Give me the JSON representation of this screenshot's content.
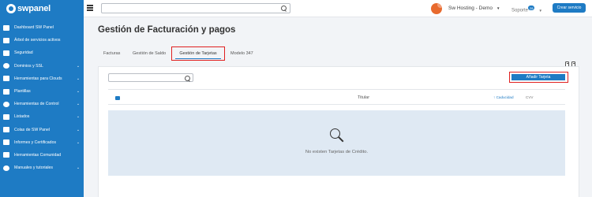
{
  "app": {
    "logo_text": "swpanel"
  },
  "sidebar": {
    "items": [
      {
        "label": "Dashboard SW Panel",
        "icon": "dashboard-icon",
        "has_children": false
      },
      {
        "label": "Árbol de servicios activos",
        "icon": "tree-icon",
        "has_children": false
      },
      {
        "label": "Seguridad",
        "icon": "shield-icon",
        "has_children": false
      },
      {
        "label": "Dominios y SSL",
        "icon": "globe-icon",
        "has_children": true
      },
      {
        "label": "Herramientas para Clouds",
        "icon": "toolbox-icon",
        "has_children": true
      },
      {
        "label": "Plantillas",
        "icon": "template-icon",
        "has_children": true
      },
      {
        "label": "Herramientas de Control",
        "icon": "check-circle-icon",
        "has_children": true
      },
      {
        "label": "Listados",
        "icon": "list-icon",
        "has_children": true
      },
      {
        "label": "Colas de SW Panel",
        "icon": "layers-icon",
        "has_children": true
      },
      {
        "label": "Informes y Certificados",
        "icon": "report-icon",
        "has_children": true
      },
      {
        "label": "Herramientas Comunidad",
        "icon": "community-icon",
        "has_children": false
      },
      {
        "label": "Manuales y tutoriales",
        "icon": "help-icon",
        "has_children": true
      }
    ],
    "chevron": "⌄"
  },
  "topbar": {
    "search_value": "",
    "account_label": "Sw Hosting - Demo",
    "account_caret": "▼",
    "support_label": "Soporte",
    "support_badge": "28",
    "support_caret": "▼",
    "create_button": "Crear servicio",
    "brand_color": "#e86a2e"
  },
  "page": {
    "title": "Gestión de Facturación y pagos",
    "tabs": [
      {
        "label": "Facturas",
        "active": false
      },
      {
        "label": "Gestión de Saldo",
        "active": false
      },
      {
        "label": "Gestión de Tarjetas",
        "active": true
      },
      {
        "label": "Modelo 347",
        "active": false
      }
    ]
  },
  "panel": {
    "search_value": "",
    "add_button": "Añadir Tarjeta",
    "columns": {
      "titular": "Titular",
      "caducidad": "Caducidad",
      "caducidad_sort": "↑",
      "cvv": "CVV"
    },
    "empty_message": "No existen Tarjetas de Crédito."
  },
  "colors": {
    "accent": "#1e7bc4",
    "highlight": "#e02020",
    "empty_bg": "#dfe9f3"
  }
}
